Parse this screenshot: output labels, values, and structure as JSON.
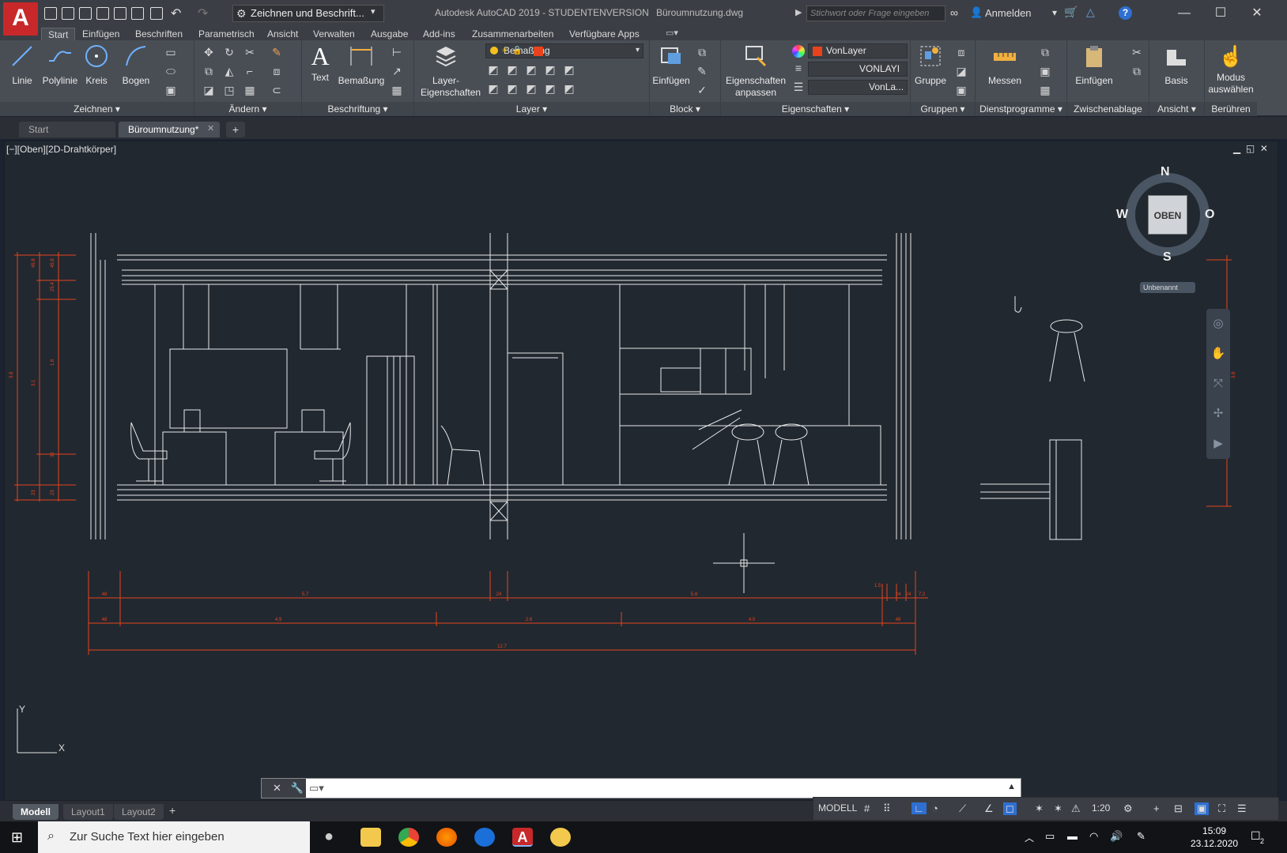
{
  "app": {
    "logo_letter": "A",
    "title": "Autodesk AutoCAD 2019 - STUDENTENVERSION",
    "file": "Büroumnutzung.dwg"
  },
  "quick_access": {
    "workspace": "Zeichnen und Beschrift..."
  },
  "search": {
    "placeholder": "Stichwort oder Frage eingeben"
  },
  "account": {
    "login": "Anmelden"
  },
  "ribbon_tabs": [
    "Start",
    "Einfügen",
    "Beschriften",
    "Parametrisch",
    "Ansicht",
    "Verwalten",
    "Ausgabe",
    "Add-ins",
    "Zusammenarbeiten",
    "Verfügbare Apps"
  ],
  "ribbon": {
    "zeichnen": {
      "title": "Zeichnen",
      "linie": "Linie",
      "polylinie": "Polylinie",
      "kreis": "Kreis",
      "bogen": "Bogen"
    },
    "aendern": {
      "title": "Ändern"
    },
    "beschriftung": {
      "title": "Beschriftung",
      "text": "Text",
      "bemassung": "Bemaßung"
    },
    "layer": {
      "title": "Layer",
      "props_line1": "Layer-",
      "props_line2": "Eigenschaften",
      "current": "Bemaßung"
    },
    "block": {
      "title": "Block",
      "einfuegen": "Einfügen"
    },
    "eigenschaften": {
      "title": "Eigenschaften",
      "anpassen_line1": "Eigenschaften",
      "anpassen_line2": "anpassen",
      "color": "VonLayer",
      "linetype": "VONLAYI",
      "lineweight": "VonLa..."
    },
    "gruppen": {
      "title": "Gruppen",
      "gruppe": "Gruppe"
    },
    "dienst": {
      "title": "Dienstprogramme",
      "messen": "Messen"
    },
    "zwischen": {
      "title": "Zwischenablage",
      "einfuegen": "Einfügen"
    },
    "ansicht": {
      "title": "Ansicht",
      "basis": "Basis"
    },
    "beruehren": {
      "title": "Berühren",
      "modus_line1": "Modus",
      "modus_line2": "auswählen"
    }
  },
  "doc_tabs": [
    "Start",
    "Büroumnutzung*"
  ],
  "viewport": {
    "label": "[−][Oben][2D-Drahtkörper]",
    "viewcube": {
      "top": "OBEN",
      "north": "N",
      "south": "S",
      "west": "W",
      "east": "O",
      "ucs": "Unbenannt"
    },
    "dims_row1": [
      "48",
      "5.7",
      "24",
      "5.8",
      "1.5",
      "24",
      "24",
      "7.2"
    ],
    "dims_row2": [
      "48",
      "4.9",
      "2.6",
      "4.0",
      "48"
    ],
    "dims_total": "12.7",
    "ucs_y": "Y",
    "ucs_x": "X",
    "vdims_left": [
      "45.8",
      "45.8",
      "25.4",
      "3.8",
      "1.6",
      "3.1",
      "32",
      "23",
      "23"
    ],
    "vdims_right": [
      "3.8"
    ]
  },
  "layout_tabs": [
    "Modell",
    "Layout1",
    "Layout2"
  ],
  "status": {
    "model": "MODELL",
    "scale": "1:20"
  },
  "taskbar": {
    "search": "Zur Suche Text hier eingeben",
    "time": "15:09",
    "date": "23.12.2020",
    "notifications": "2"
  },
  "colors": {
    "dim": "#e8431c",
    "draw": "#e9e9e9",
    "accent": "#c8282a"
  }
}
